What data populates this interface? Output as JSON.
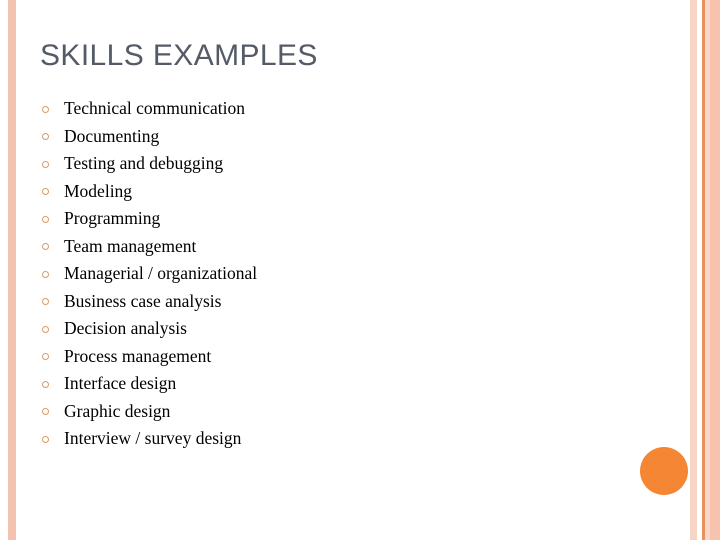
{
  "slide": {
    "title": "SKILLS EXAMPLES",
    "bullets": [
      {
        "label": "Technical communication"
      },
      {
        "label": "Documenting"
      },
      {
        "label": "Testing and debugging"
      },
      {
        "label": "Modeling"
      },
      {
        "label": "Programming"
      },
      {
        "label": "Team management"
      },
      {
        "label": "Managerial / organizational"
      },
      {
        "label": "Business case analysis"
      },
      {
        "label": "Decision analysis"
      },
      {
        "label": "Process management"
      },
      {
        "label": "Interface design"
      },
      {
        "label": "Graphic design"
      },
      {
        "label": "Interview / survey design"
      }
    ],
    "decoration": {
      "left_stripe_color": "#F4C3B0",
      "right_stripe_outer_color": "#F6D4C6",
      "right_stripe_line_color": "#E8915E",
      "right_stripe_inner_color": "#F9D6C7",
      "right_stripe_band_color": "#F8C3AE",
      "accent_circle_color": "#F58634",
      "bullet_marker_color": "#D99A63",
      "title_color": "#555B66",
      "body_text_color": "#000000",
      "background_color": "#FFFFFF"
    }
  }
}
